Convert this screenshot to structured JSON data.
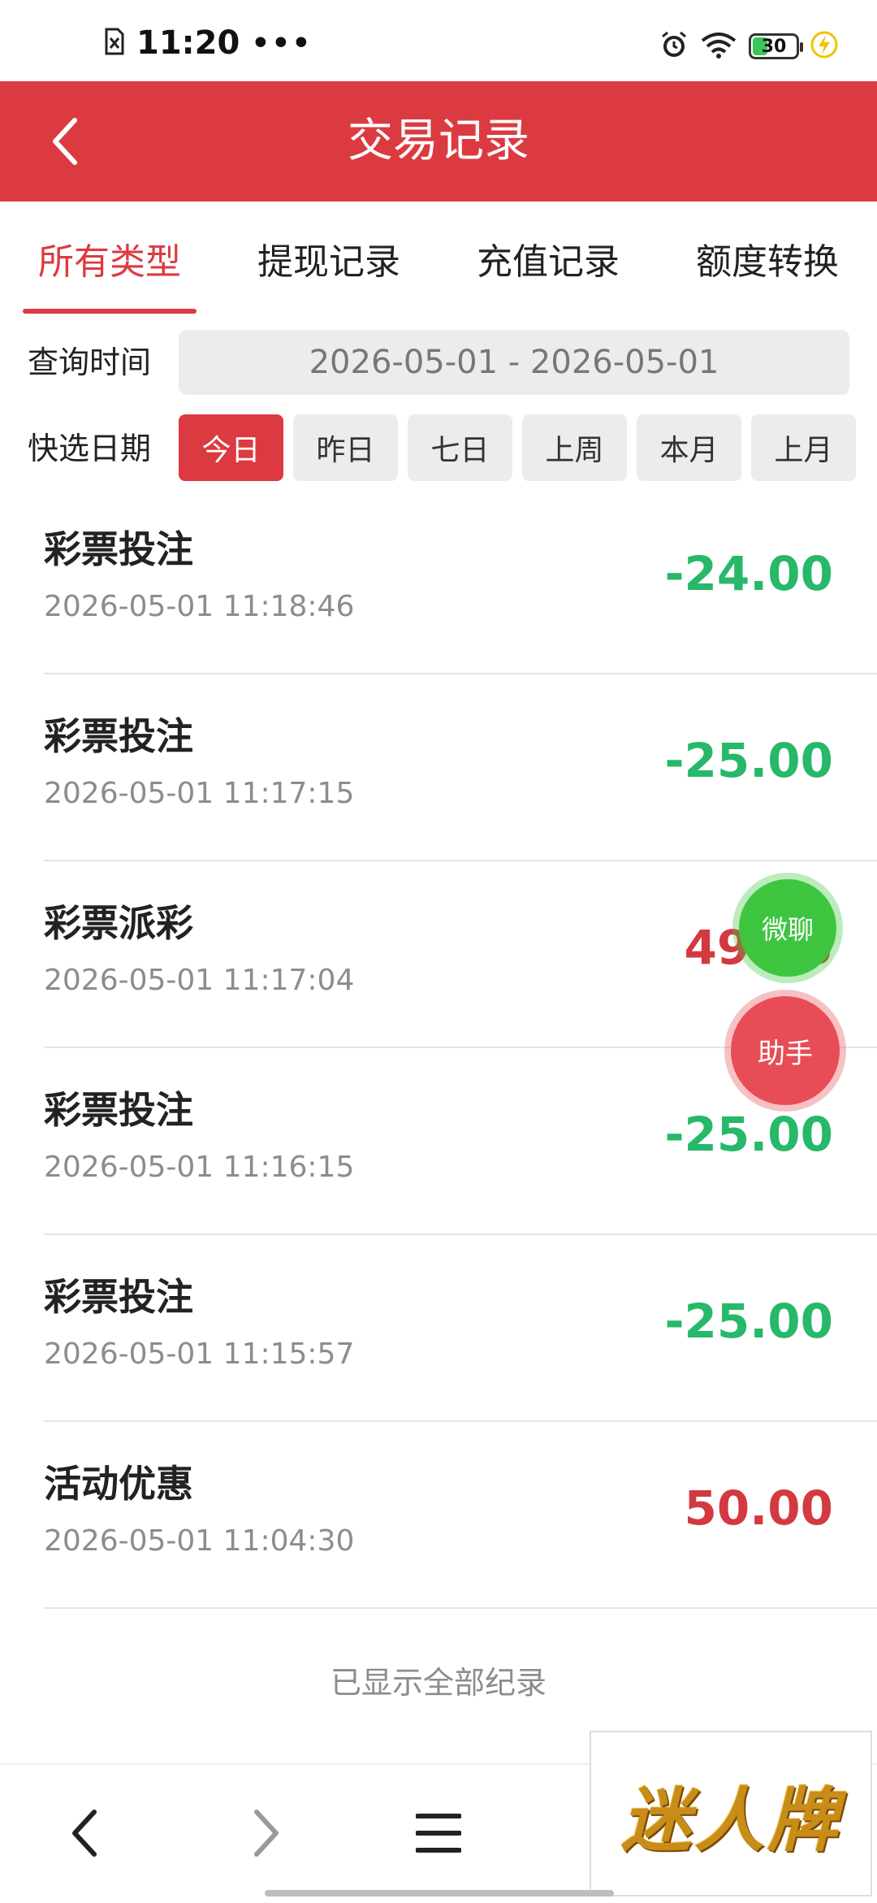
{
  "status_bar": {
    "time": "11:20",
    "dots": "•••",
    "battery": "30"
  },
  "header": {
    "title": "交易记录"
  },
  "tabs": [
    {
      "label": "所有类型",
      "active": true
    },
    {
      "label": "提现记录",
      "active": false
    },
    {
      "label": "充值记录",
      "active": false
    },
    {
      "label": "额度转换",
      "active": false
    }
  ],
  "query": {
    "label": "查询时间",
    "range": "2026-05-01 - 2026-05-01"
  },
  "quick": {
    "label": "快选日期",
    "options": [
      {
        "label": "今日",
        "active": true
      },
      {
        "label": "昨日",
        "active": false
      },
      {
        "label": "七日",
        "active": false
      },
      {
        "label": "上周",
        "active": false
      },
      {
        "label": "本月",
        "active": false
      },
      {
        "label": "上月",
        "active": false
      }
    ]
  },
  "records": [
    {
      "name": "彩票投注",
      "time": "2026-05-01 11:18:46",
      "amount": "-24.00",
      "type": "neg"
    },
    {
      "name": "彩票投注",
      "time": "2026-05-01 11:17:15",
      "amount": "-25.00",
      "type": "neg"
    },
    {
      "name": "彩票派彩",
      "time": "2026-05-01 11:17:04",
      "amount": "49.25",
      "type": "pos"
    },
    {
      "name": "彩票投注",
      "time": "2026-05-01 11:16:15",
      "amount": "-25.00",
      "type": "neg"
    },
    {
      "name": "彩票投注",
      "time": "2026-05-01 11:15:57",
      "amount": "-25.00",
      "type": "neg"
    },
    {
      "name": "活动优惠",
      "time": "2026-05-01 11:04:30",
      "amount": "50.00",
      "type": "pos"
    }
  ],
  "footer_note": "已显示全部纪录",
  "floating": {
    "chat_label": "微聊",
    "help_label": "助手"
  },
  "logo_text": "迷人牌",
  "colors": {
    "accent": "#dc3a41",
    "negative": "#27b86a",
    "positive": "#d23a3f"
  }
}
